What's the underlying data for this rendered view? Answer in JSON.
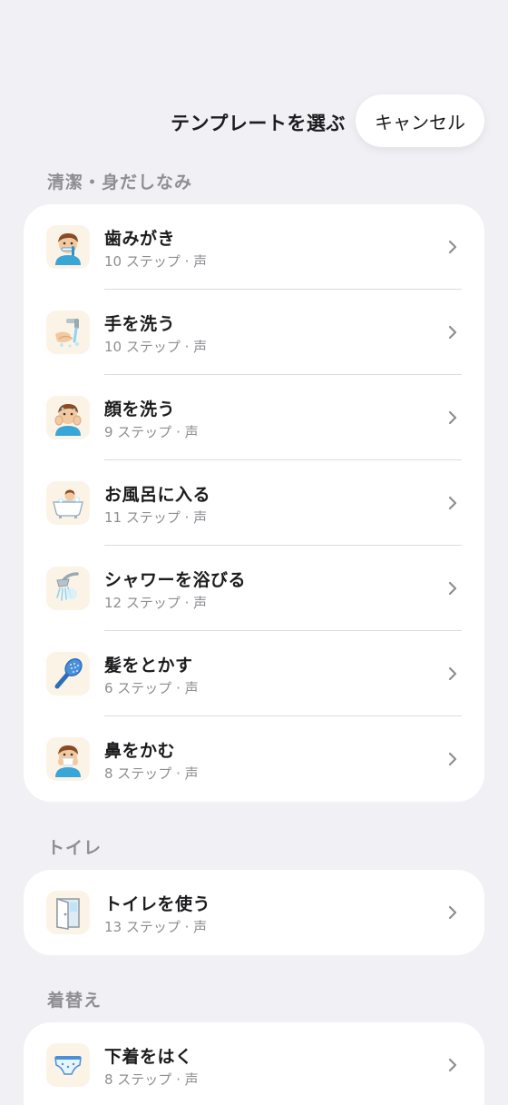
{
  "header": {
    "title": "テンプレートを選ぶ",
    "cancel_label": "キャンセル"
  },
  "sections": [
    {
      "title": "清潔・身だしなみ",
      "items": [
        {
          "title": "歯みがき",
          "subtitle": "10 ステップ · 声",
          "icon": "boy-brushing-teeth-icon"
        },
        {
          "title": "手を洗う",
          "subtitle": "10 ステップ · 声",
          "icon": "hand-washing-icon"
        },
        {
          "title": "顔を洗う",
          "subtitle": "9 ステップ · 声",
          "icon": "boy-washing-face-icon"
        },
        {
          "title": "お風呂に入る",
          "subtitle": "11 ステップ · 声",
          "icon": "bathtub-icon"
        },
        {
          "title": "シャワーを浴びる",
          "subtitle": "12 ステップ · 声",
          "icon": "shower-head-icon"
        },
        {
          "title": "髪をとかす",
          "subtitle": "6 ステップ · 声",
          "icon": "hairbrush-icon"
        },
        {
          "title": "鼻をかむ",
          "subtitle": "8 ステップ · 声",
          "icon": "boy-blowing-nose-icon"
        }
      ]
    },
    {
      "title": "トイレ",
      "items": [
        {
          "title": "トイレを使う",
          "subtitle": "13 ステップ · 声",
          "icon": "toilet-door-icon"
        }
      ]
    },
    {
      "title": "着替え",
      "items": [
        {
          "title": "下着をはく",
          "subtitle": "8 ステップ · 声",
          "icon": "underwear-icon"
        }
      ]
    }
  ]
}
